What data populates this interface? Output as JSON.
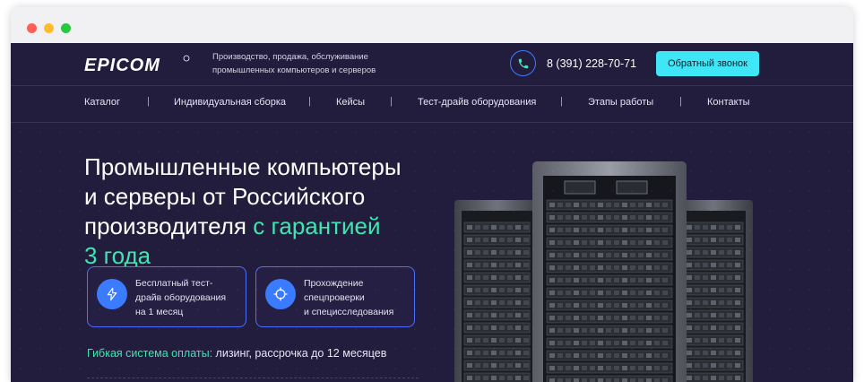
{
  "window": {
    "controls": [
      "close",
      "minimize",
      "maximize"
    ]
  },
  "header": {
    "logo_text": "EPICOM",
    "tagline_line1": "Производство, продажа, обслуживание",
    "tagline_line2": "промышленных компьютеров и серверов",
    "phone": "8 (391) 228-70-71",
    "callback_button": "Обратный звонок"
  },
  "nav": {
    "items": [
      {
        "label": "Каталог"
      },
      {
        "label": "Индивидуальная сборка"
      },
      {
        "label": "Кейсы"
      },
      {
        "label": "Тест-драйв оборудования"
      },
      {
        "label": "Этапы работы"
      },
      {
        "label": "Контакты"
      }
    ],
    "separator": "|"
  },
  "hero": {
    "title_line1": "Промышленные компьютеры",
    "title_line2": "и серверы от Российского",
    "title_line3_main": "производителя",
    "title_line3_accent": "с гарантией",
    "title_line4_accent": "3 года"
  },
  "features": [
    {
      "icon": "lightning-icon",
      "lines": [
        "Бесплатный тест-",
        "драйв оборудования",
        "на 1 месяц"
      ]
    },
    {
      "icon": "target-icon",
      "lines": [
        "Прохождение",
        "спецпроверки",
        "и специсследования"
      ]
    }
  ],
  "payment": {
    "accent": "Гибкая система оплаты:",
    "text": "лизинг, рассрочка до 12 месяцев"
  },
  "colors": {
    "background": "#221c3d",
    "accent_green": "#3fe6b0",
    "accent_cyan": "#3fe6f5",
    "accent_blue": "#3b7bff"
  }
}
